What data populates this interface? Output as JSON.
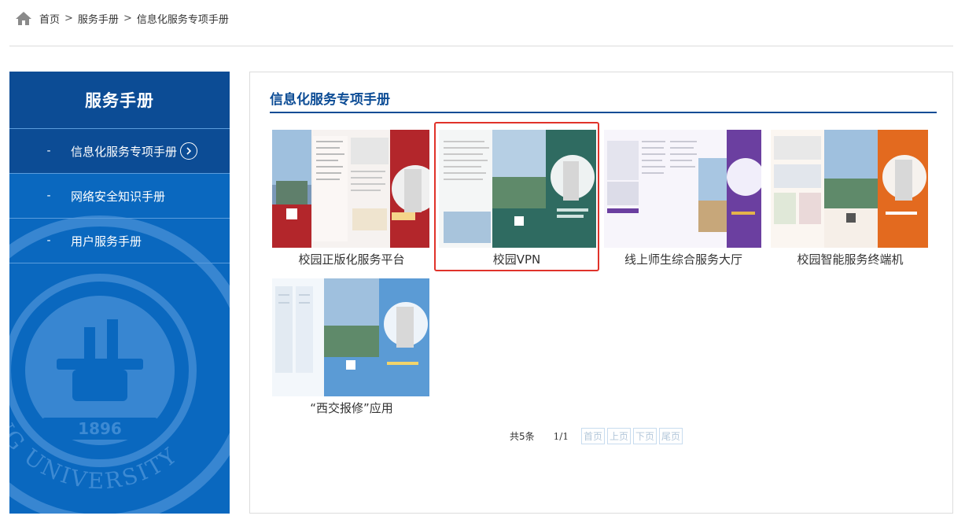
{
  "breadcrumb": {
    "items": [
      "首页",
      "服务手册",
      "信息化服务专项手册"
    ],
    "separator": ">"
  },
  "sidebar": {
    "title": "服务手册",
    "items": [
      {
        "dash": "-",
        "label": "信息化服务专项手册",
        "active": true
      },
      {
        "dash": "-",
        "label": "网络安全知识手册",
        "active": false
      },
      {
        "dash": "-",
        "label": "用户服务手册",
        "active": false
      }
    ],
    "seal_year": "1896",
    "seal_text": "ONG UNIVERSITY"
  },
  "content": {
    "title": "信息化服务专项手册",
    "cards": [
      {
        "caption": "校园正版化服务平台",
        "accent": "#b3262b"
      },
      {
        "caption": "校园VPN",
        "accent": "#2f6b61"
      },
      {
        "caption": "线上师生综合服务大厅",
        "accent": "#6b3fa0"
      },
      {
        "caption": "校园智能服务终端机",
        "accent": "#e36a1f"
      },
      {
        "caption": "“西交报修”应用",
        "accent": "#5b9bd5"
      }
    ]
  },
  "pager": {
    "total": "共5条",
    "pages": "1/1",
    "first": "首页",
    "prev": "上页",
    "next": "下页",
    "last": "尾页"
  },
  "colors": {
    "nav_dark": "#0c4c95",
    "nav_blue": "#0a68bf",
    "selected_border": "#e0322a"
  }
}
